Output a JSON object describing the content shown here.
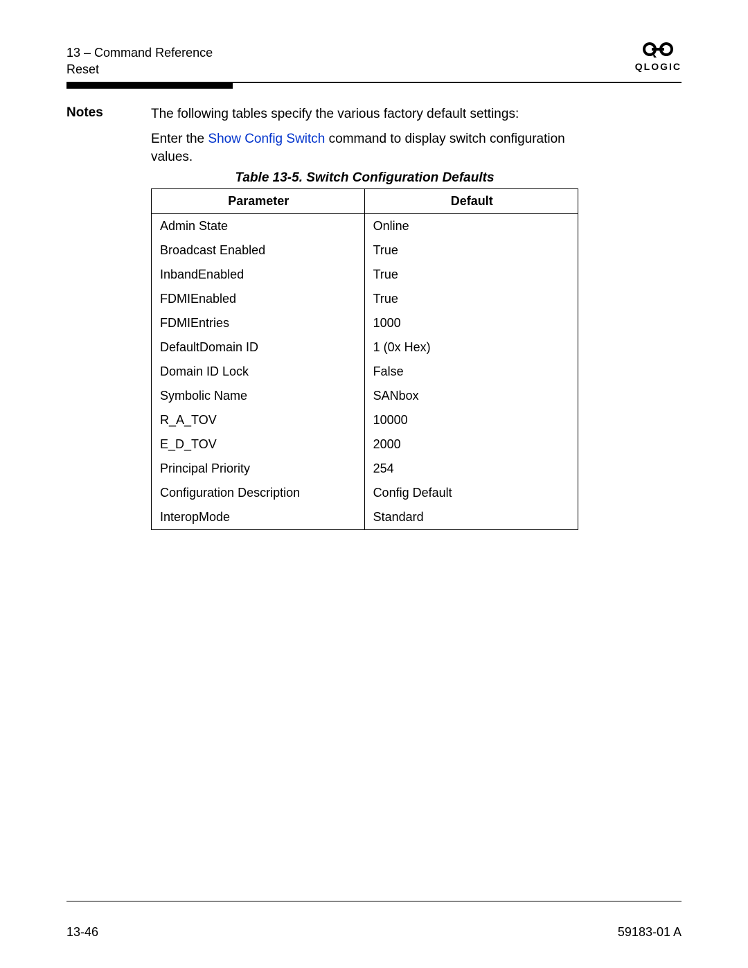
{
  "header": {
    "chapter": "13 – Command Reference",
    "section": "Reset",
    "logo_text": "QLOGIC"
  },
  "notes": {
    "label": "Notes",
    "line1": "The following tables specify the various factory default settings:",
    "line2_pre": "Enter the ",
    "line2_link": "Show Config Switch",
    "line2_post": " command to display switch configuration values."
  },
  "table": {
    "caption": "Table 13-5. Switch Configuration Defaults",
    "headers": {
      "c1": "Parameter",
      "c2": "Default"
    },
    "rows": [
      {
        "p": "Admin State",
        "d": "Online"
      },
      {
        "p": "Broadcast Enabled",
        "d": "True"
      },
      {
        "p": "InbandEnabled",
        "d": "True"
      },
      {
        "p": "FDMIEnabled",
        "d": "True"
      },
      {
        "p": "FDMIEntries",
        "d": "1000"
      },
      {
        "p": "DefaultDomain ID",
        "d": "1 (0x Hex)"
      },
      {
        "p": "Domain ID Lock",
        "d": "False"
      },
      {
        "p": "Symbolic Name",
        "d": "SANbox"
      },
      {
        "p": "R_A_TOV",
        "d": "10000"
      },
      {
        "p": "E_D_TOV",
        "d": "2000"
      },
      {
        "p": "Principal Priority",
        "d": "254"
      },
      {
        "p": "Configuration Description",
        "d": "Config Default"
      },
      {
        "p": "InteropMode",
        "d": "Standard"
      }
    ]
  },
  "footer": {
    "page": "13-46",
    "docnum": "59183-01 A"
  }
}
